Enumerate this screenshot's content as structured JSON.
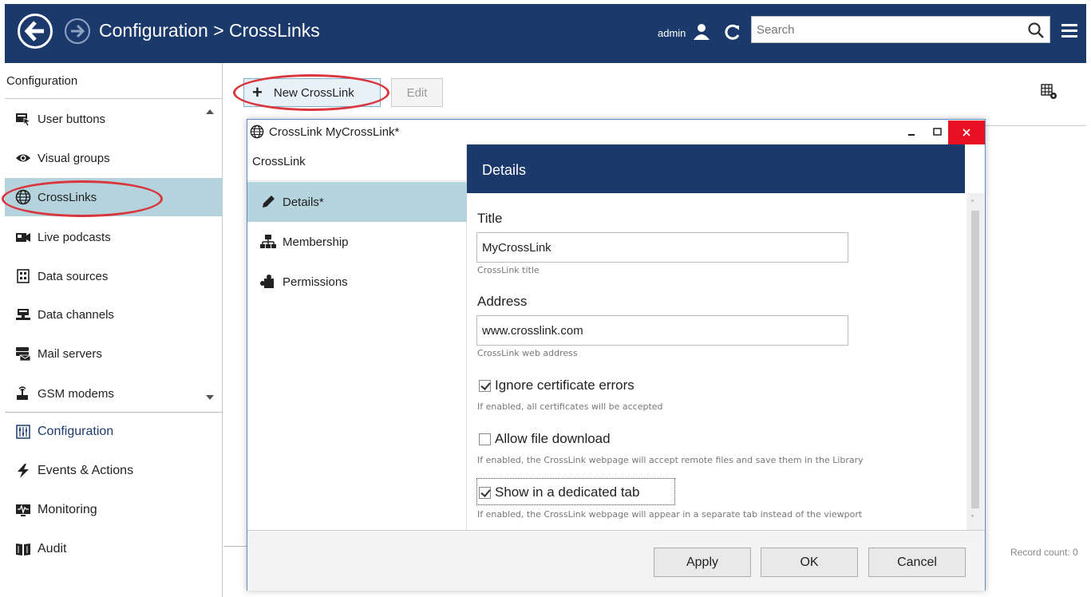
{
  "header": {
    "title": "Configuration > CrossLinks",
    "user": "admin",
    "search_placeholder": "Search"
  },
  "sidebar": {
    "heading": "Configuration",
    "items": [
      {
        "label": "User buttons",
        "icon": "user-buttons-icon"
      },
      {
        "label": "Visual groups",
        "icon": "eye-icon"
      },
      {
        "label": "CrossLinks",
        "icon": "globe-icon",
        "active": true
      },
      {
        "label": "Live podcasts",
        "icon": "podcast-icon"
      },
      {
        "label": "Data sources",
        "icon": "data-source-icon"
      },
      {
        "label": "Data channels",
        "icon": "data-channel-icon"
      },
      {
        "label": "Mail servers",
        "icon": "mail-server-icon"
      },
      {
        "label": "GSM modems",
        "icon": "modem-icon"
      }
    ],
    "main": [
      {
        "label": "Configuration",
        "icon": "configuration-icon",
        "selected": true
      },
      {
        "label": "Events & Actions",
        "icon": "lightning-icon"
      },
      {
        "label": "Monitoring",
        "icon": "monitoring-icon"
      },
      {
        "label": "Audit",
        "icon": "book-icon"
      }
    ]
  },
  "toolbar": {
    "new_label": "New CrossLink",
    "edit_label": "Edit"
  },
  "record_count": "Record count: 0",
  "dialog": {
    "title": "CrossLink MyCrossLink*",
    "nav_heading": "CrossLink",
    "nav": [
      {
        "label": "Details*",
        "icon": "pencil-icon",
        "active": true
      },
      {
        "label": "Membership",
        "icon": "membership-icon"
      },
      {
        "label": "Permissions",
        "icon": "permissions-icon"
      }
    ],
    "section_title": "Details",
    "title_label": "Title",
    "title_value": "MyCrossLink",
    "title_hint": "CrossLink title",
    "address_label": "Address",
    "address_value": "www.crosslink.com",
    "address_hint": "CrossLink web address",
    "checkboxes": [
      {
        "label": "Ignore certificate errors",
        "checked": true,
        "hint": "If enabled, all certificates will be accepted"
      },
      {
        "label": "Allow file download",
        "checked": false,
        "hint": "If enabled, the CrossLink webpage will accept remote files and save them in the Library"
      },
      {
        "label": "Show in a dedicated tab",
        "checked": true,
        "hint": "If enabled, the CrossLink webpage will appear in a separate tab instead of the viewport"
      }
    ],
    "buttons": {
      "apply": "Apply",
      "ok": "OK",
      "cancel": "Cancel"
    }
  },
  "colors": {
    "header_bg": "#1b3a6b",
    "active_bg": "#b4d3dd",
    "highlight": "#d9363e",
    "close_bg": "#e81123"
  }
}
